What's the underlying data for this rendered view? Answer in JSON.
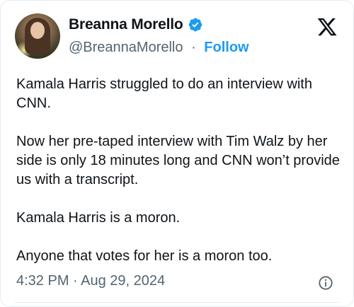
{
  "author": {
    "name": "Breanna Morello",
    "handle": "@BreannaMorello",
    "separator": "·",
    "follow_label": "Follow",
    "verified_color": "#1d9bf0"
  },
  "tweet": {
    "paragraphs": [
      "Kamala Harris struggled to do an interview with CNN.",
      "Now her pre-taped interview with Tim Walz by her side is only 18 minutes long and CNN won’t provide us with a transcript.",
      "Kamala Harris is a moron.",
      "Anyone that votes for her is a moron too."
    ],
    "timestamp": "4:32 PM · Aug 29, 2024"
  },
  "icons": {
    "verified": "verified-badge-icon",
    "platform": "x-logo-icon",
    "info": "info-icon"
  }
}
